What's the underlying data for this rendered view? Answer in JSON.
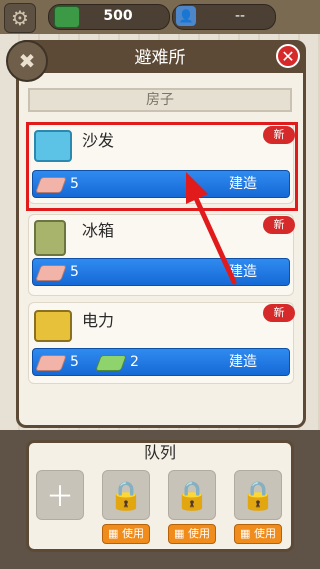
{
  "topbar": {
    "cash_value": "500",
    "population_value": "--"
  },
  "panel": {
    "title": "避难所",
    "category": "房子",
    "close_symbol": "✕"
  },
  "items": [
    {
      "name": "沙发",
      "badge": "新",
      "cost_primary": "5",
      "cost_secondary": "",
      "build_label": "建造"
    },
    {
      "name": "冰箱",
      "badge": "新",
      "cost_primary": "5",
      "cost_secondary": "",
      "build_label": "建造"
    },
    {
      "name": "电力",
      "badge": "新",
      "cost_primary": "5",
      "cost_secondary": "2",
      "build_label": "建造"
    }
  ],
  "queue": {
    "title": "队列",
    "use_labels": [
      "使用",
      "使用",
      "使用"
    ]
  },
  "colors": {
    "accent_blue": "#1f7be6",
    "badge_red": "#d62a2a",
    "highlight_red": "#e11b1b",
    "use_orange": "#f08c1c"
  },
  "icons": {
    "settings": "gear-icon",
    "cash": "cash-icon",
    "population": "person-icon",
    "tools": "wrench-screwdriver-icon",
    "lock": "lock-icon",
    "add": "plus-icon",
    "film": "film-icon"
  }
}
